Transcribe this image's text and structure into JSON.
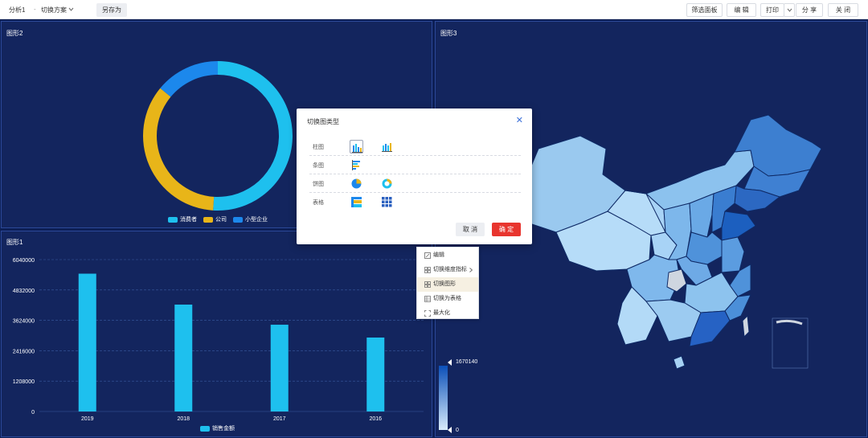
{
  "toolbar": {
    "analysis_label": "分析1",
    "scheme_label": "切换方案",
    "save_as": "另存为",
    "filter_panel": "筛选面板",
    "edit": "编 辑",
    "print": "打印",
    "share": "分 享",
    "close": "关 闭"
  },
  "donut": {
    "title": "图形2",
    "legend": [
      "消费者",
      "公司",
      "小型企业"
    ],
    "colors": [
      "#1ec0ee",
      "#e8b519",
      "#1c88ec"
    ]
  },
  "chart_data": [
    {
      "type": "pie",
      "title": "",
      "categories": [
        "消费者",
        "公司",
        "小型企业"
      ],
      "values": [
        51,
        35,
        14
      ],
      "colors": [
        "#1ec0ee",
        "#e8b519",
        "#1c88ec"
      ]
    },
    {
      "type": "bar",
      "title": "",
      "categories": [
        "2019",
        "2018",
        "2017",
        "2016"
      ],
      "series": [
        {
          "name": "销售金额",
          "values": [
            5480000,
            4250000,
            3450000,
            2940000
          ],
          "color": "#1ec0ee"
        }
      ],
      "yticks": [
        "0",
        "1208000",
        "2416000",
        "3624000",
        "4832000",
        "6040000"
      ],
      "ylim": [
        0,
        6040000
      ],
      "grid": true,
      "legend": "bottom"
    }
  ],
  "bar": {
    "title": "图形1",
    "legend": "销售金额"
  },
  "map": {
    "title": "图形3",
    "scale_max": "1670140",
    "scale_min": "0"
  },
  "modal": {
    "title": "切换图类型",
    "rows": [
      "柱图",
      "条图",
      "饼图",
      "表格"
    ],
    "cancel": "取 消",
    "confirm": "确 定"
  },
  "context_menu": {
    "items": [
      "编辑",
      "切换维度指标",
      "切换图形",
      "切换为表格",
      "最大化"
    ]
  }
}
